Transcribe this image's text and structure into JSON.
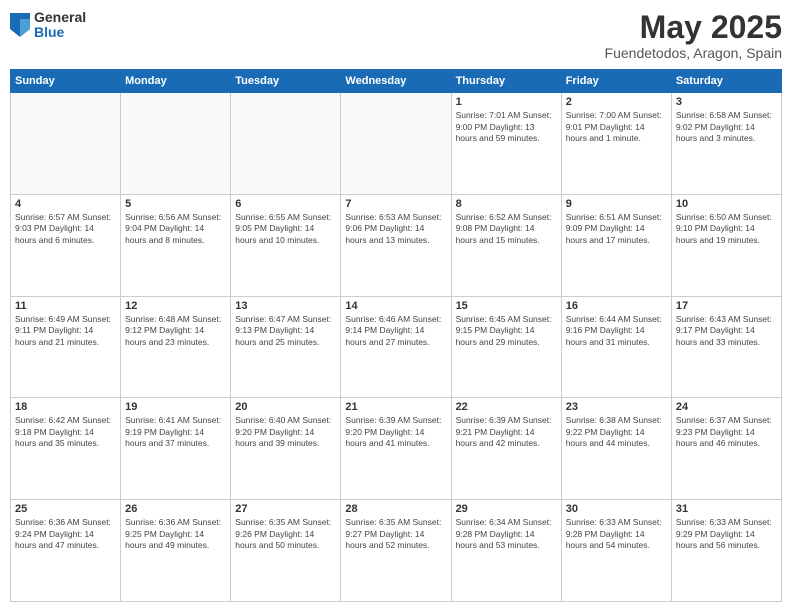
{
  "logo": {
    "general": "General",
    "blue": "Blue"
  },
  "title": {
    "month": "May 2025",
    "location": "Fuendetodos, Aragon, Spain"
  },
  "days_header": [
    "Sunday",
    "Monday",
    "Tuesday",
    "Wednesday",
    "Thursday",
    "Friday",
    "Saturday"
  ],
  "weeks": [
    [
      {
        "day": "",
        "detail": ""
      },
      {
        "day": "",
        "detail": ""
      },
      {
        "day": "",
        "detail": ""
      },
      {
        "day": "",
        "detail": ""
      },
      {
        "day": "1",
        "detail": "Sunrise: 7:01 AM\nSunset: 9:00 PM\nDaylight: 13 hours\nand 59 minutes."
      },
      {
        "day": "2",
        "detail": "Sunrise: 7:00 AM\nSunset: 9:01 PM\nDaylight: 14 hours\nand 1 minute."
      },
      {
        "day": "3",
        "detail": "Sunrise: 6:58 AM\nSunset: 9:02 PM\nDaylight: 14 hours\nand 3 minutes."
      }
    ],
    [
      {
        "day": "4",
        "detail": "Sunrise: 6:57 AM\nSunset: 9:03 PM\nDaylight: 14 hours\nand 6 minutes."
      },
      {
        "day": "5",
        "detail": "Sunrise: 6:56 AM\nSunset: 9:04 PM\nDaylight: 14 hours\nand 8 minutes."
      },
      {
        "day": "6",
        "detail": "Sunrise: 6:55 AM\nSunset: 9:05 PM\nDaylight: 14 hours\nand 10 minutes."
      },
      {
        "day": "7",
        "detail": "Sunrise: 6:53 AM\nSunset: 9:06 PM\nDaylight: 14 hours\nand 13 minutes."
      },
      {
        "day": "8",
        "detail": "Sunrise: 6:52 AM\nSunset: 9:08 PM\nDaylight: 14 hours\nand 15 minutes."
      },
      {
        "day": "9",
        "detail": "Sunrise: 6:51 AM\nSunset: 9:09 PM\nDaylight: 14 hours\nand 17 minutes."
      },
      {
        "day": "10",
        "detail": "Sunrise: 6:50 AM\nSunset: 9:10 PM\nDaylight: 14 hours\nand 19 minutes."
      }
    ],
    [
      {
        "day": "11",
        "detail": "Sunrise: 6:49 AM\nSunset: 9:11 PM\nDaylight: 14 hours\nand 21 minutes."
      },
      {
        "day": "12",
        "detail": "Sunrise: 6:48 AM\nSunset: 9:12 PM\nDaylight: 14 hours\nand 23 minutes."
      },
      {
        "day": "13",
        "detail": "Sunrise: 6:47 AM\nSunset: 9:13 PM\nDaylight: 14 hours\nand 25 minutes."
      },
      {
        "day": "14",
        "detail": "Sunrise: 6:46 AM\nSunset: 9:14 PM\nDaylight: 14 hours\nand 27 minutes."
      },
      {
        "day": "15",
        "detail": "Sunrise: 6:45 AM\nSunset: 9:15 PM\nDaylight: 14 hours\nand 29 minutes."
      },
      {
        "day": "16",
        "detail": "Sunrise: 6:44 AM\nSunset: 9:16 PM\nDaylight: 14 hours\nand 31 minutes."
      },
      {
        "day": "17",
        "detail": "Sunrise: 6:43 AM\nSunset: 9:17 PM\nDaylight: 14 hours\nand 33 minutes."
      }
    ],
    [
      {
        "day": "18",
        "detail": "Sunrise: 6:42 AM\nSunset: 9:18 PM\nDaylight: 14 hours\nand 35 minutes."
      },
      {
        "day": "19",
        "detail": "Sunrise: 6:41 AM\nSunset: 9:19 PM\nDaylight: 14 hours\nand 37 minutes."
      },
      {
        "day": "20",
        "detail": "Sunrise: 6:40 AM\nSunset: 9:20 PM\nDaylight: 14 hours\nand 39 minutes."
      },
      {
        "day": "21",
        "detail": "Sunrise: 6:39 AM\nSunset: 9:20 PM\nDaylight: 14 hours\nand 41 minutes."
      },
      {
        "day": "22",
        "detail": "Sunrise: 6:39 AM\nSunset: 9:21 PM\nDaylight: 14 hours\nand 42 minutes."
      },
      {
        "day": "23",
        "detail": "Sunrise: 6:38 AM\nSunset: 9:22 PM\nDaylight: 14 hours\nand 44 minutes."
      },
      {
        "day": "24",
        "detail": "Sunrise: 6:37 AM\nSunset: 9:23 PM\nDaylight: 14 hours\nand 46 minutes."
      }
    ],
    [
      {
        "day": "25",
        "detail": "Sunrise: 6:36 AM\nSunset: 9:24 PM\nDaylight: 14 hours\nand 47 minutes."
      },
      {
        "day": "26",
        "detail": "Sunrise: 6:36 AM\nSunset: 9:25 PM\nDaylight: 14 hours\nand 49 minutes."
      },
      {
        "day": "27",
        "detail": "Sunrise: 6:35 AM\nSunset: 9:26 PM\nDaylight: 14 hours\nand 50 minutes."
      },
      {
        "day": "28",
        "detail": "Sunrise: 6:35 AM\nSunset: 9:27 PM\nDaylight: 14 hours\nand 52 minutes."
      },
      {
        "day": "29",
        "detail": "Sunrise: 6:34 AM\nSunset: 9:28 PM\nDaylight: 14 hours\nand 53 minutes."
      },
      {
        "day": "30",
        "detail": "Sunrise: 6:33 AM\nSunset: 9:28 PM\nDaylight: 14 hours\nand 54 minutes."
      },
      {
        "day": "31",
        "detail": "Sunrise: 6:33 AM\nSunset: 9:29 PM\nDaylight: 14 hours\nand 56 minutes."
      }
    ]
  ]
}
